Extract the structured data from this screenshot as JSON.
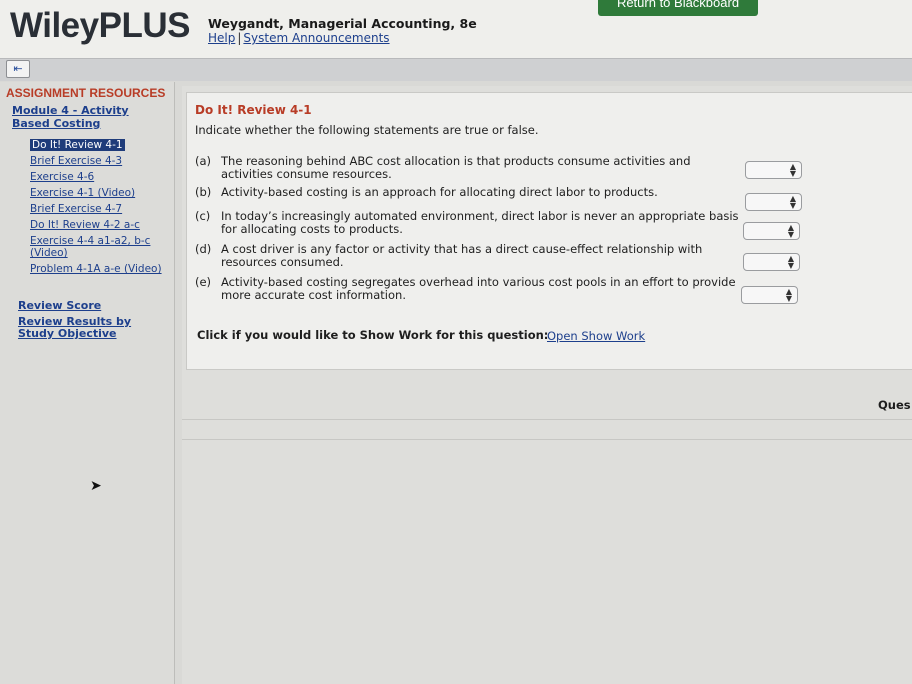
{
  "header": {
    "logo": "WileyPLUS",
    "book_title": "Weygandt, Managerial Accounting, 8e",
    "help_link": "Help",
    "separator": "|",
    "announcements_link": "System Announcements",
    "return_button": "Return to Blackboard"
  },
  "sidebar": {
    "title": "ASSIGNMENT RESOURCES",
    "module_link": "Module 4 - Activity Based Costing",
    "items": [
      {
        "label": "Do It! Review 4-1",
        "active": true
      },
      {
        "label": "Brief Exercise 4-3"
      },
      {
        "label": "Exercise 4-6"
      },
      {
        "label": "Exercise 4-1 (Video)"
      },
      {
        "label": "Brief Exercise 4-7"
      },
      {
        "label": "Do It! Review 4-2 a-c"
      },
      {
        "label": "Exercise 4-4 a1-a2, b-c (Video)"
      },
      {
        "label": "Problem 4-1A a-e (Video)"
      }
    ],
    "review_score": "Review Score",
    "review_results": "Review Results by Study Objective"
  },
  "question": {
    "title": "Do It! Review 4-1",
    "instruction": "Indicate whether the following statements are true or false.",
    "statements": [
      {
        "letter": "(a)",
        "text": "The reasoning behind ABC cost allocation is that products consume activities and activities consume resources.",
        "selected": ""
      },
      {
        "letter": "(b)",
        "text": "Activity-based costing is an approach for allocating direct labor to products.",
        "selected": ""
      },
      {
        "letter": "(c)",
        "text": "In today’s increasingly automated environment, direct labor is never an appropriate basis for allocating costs to products.",
        "selected": ""
      },
      {
        "letter": "(d)",
        "text": "A cost driver is any factor or activity that has a direct cause-effect relationship with resources consumed.",
        "selected": ""
      },
      {
        "letter": "(e)",
        "text": "Activity-based costing segregates overhead into various cost pools in an effort to provide more accurate cost information.",
        "selected": ""
      }
    ],
    "show_work_prompt": "Click if you would like to Show Work for this question:",
    "show_work_link": "Open Show Work"
  },
  "footer": {
    "ques_label": "Ques"
  },
  "colors": {
    "accent_red": "#b83c26",
    "link_blue": "#1d3f8c",
    "active_bg": "#1f3c7a",
    "return_green": "#2f7a3a"
  }
}
